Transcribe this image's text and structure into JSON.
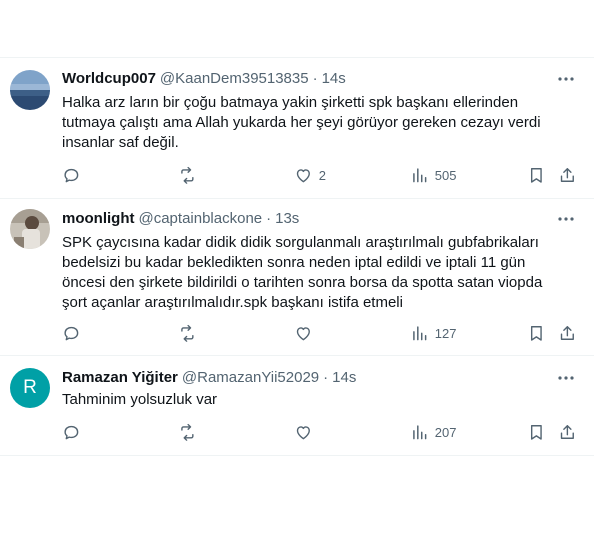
{
  "tweets": [
    {
      "name": "Worldcup007",
      "handle": "@KaanDem39513835",
      "separator": "·",
      "time": "14s",
      "text": "Halka arz ların bir çoğu batmaya yakin şirketti spk başkanı ellerinden tutmaya çalıştı ama Allah yukarda her şeyi görüyor gereken cezayı verdi insanlar saf değil.",
      "replies": "",
      "reposts": "",
      "likes": "2",
      "views": "505",
      "avatar": "landscape-photo"
    },
    {
      "name": "moonlight",
      "handle": "@captainblackone",
      "separator": "·",
      "time": "13s",
      "text": "SPK çaycısına kadar didik didik sorgulanmalı araştırılmalı gubfabrikaları bedelsizi bu kadar bekledikten sonra neden iptal edildi ve iptali 11 gün öncesi den şirkete bildirildi o tarihten sonra borsa da spotta satan viopda şort açanlar araştırılmalıdır.spk başkanı istifa etmeli",
      "replies": "",
      "reposts": "",
      "likes": "",
      "views": "127",
      "avatar": "person-photo"
    },
    {
      "name": "Ramazan Yiğiter",
      "handle": "@RamazanYii52029",
      "separator": "·",
      "time": "14s",
      "text": "Tahminim yolsuzluk var",
      "replies": "",
      "reposts": "",
      "likes": "",
      "views": "207",
      "avatar_letter": "R",
      "avatar_color": "#00a0a6"
    }
  ],
  "colors": {
    "text": "#0f1419",
    "secondary": "#536471",
    "border": "#eff3f4"
  },
  "icons": [
    "more-icon",
    "reply-icon",
    "repost-icon",
    "like-icon",
    "views-icon",
    "bookmark-icon",
    "share-icon"
  ]
}
